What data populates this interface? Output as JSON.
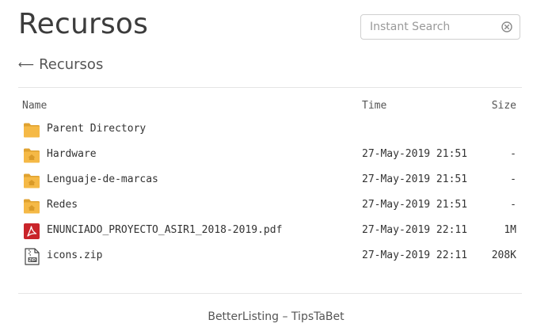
{
  "header": {
    "title": "Recursos",
    "search_placeholder": "Instant Search"
  },
  "breadcrumb": {
    "arrow": "⟵",
    "label": "Recursos"
  },
  "table": {
    "columns": {
      "name": "Name",
      "time": "Time",
      "size": "Size"
    },
    "rows": [
      {
        "icon": "folder-up-icon",
        "name": "Parent Directory",
        "time": "",
        "size": ""
      },
      {
        "icon": "folder-icon",
        "name": "Hardware",
        "time": "27-May-2019 21:51",
        "size": "-"
      },
      {
        "icon": "folder-icon",
        "name": "Lenguaje-de-marcas",
        "time": "27-May-2019 21:51",
        "size": "-"
      },
      {
        "icon": "folder-icon",
        "name": "Redes",
        "time": "27-May-2019 21:51",
        "size": "-"
      },
      {
        "icon": "pdf-file-icon",
        "name": "ENUNCIADO_PROYECTO_ASIR1_2018-2019.pdf",
        "time": "27-May-2019 22:11",
        "size": "1M"
      },
      {
        "icon": "zip-file-icon",
        "name": "icons.zip",
        "time": "27-May-2019 22:11",
        "size": "208K"
      }
    ]
  },
  "footer": {
    "text": "BetterListing – TipsTaBet"
  },
  "colors": {
    "folder": "#f5b946",
    "folder_dark": "#e0a230",
    "pdf": "#c9242a"
  }
}
